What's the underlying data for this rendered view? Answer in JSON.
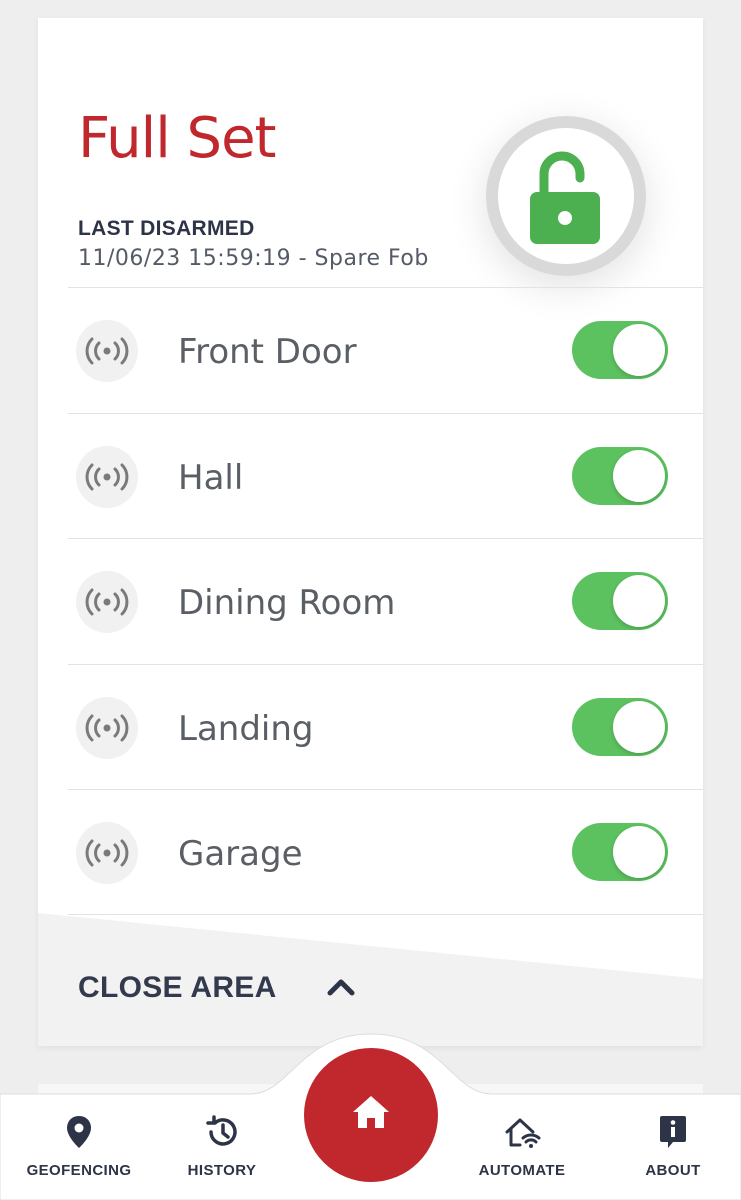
{
  "area": {
    "title": "Full Set",
    "last_event_label": "LAST DISARMED",
    "last_event_value": "11/06/23 15:59:19 - Spare Fob",
    "status_icon": "unlocked-padlock-icon",
    "status_color": "#4caf50",
    "title_color": "#c0282d"
  },
  "zones": [
    {
      "label": "Front Door",
      "enabled": true
    },
    {
      "label": "Hall",
      "enabled": true
    },
    {
      "label": "Dining Room",
      "enabled": true
    },
    {
      "label": "Landing",
      "enabled": true
    },
    {
      "label": "Garage",
      "enabled": true
    }
  ],
  "zone_icon": "wireless-sensor-icon",
  "toggle_on_color": "#5cc15f",
  "close_area": {
    "label": "CLOSE AREA",
    "icon": "chevron-up-icon"
  },
  "nav": {
    "items": [
      {
        "label": "GEOFENCING",
        "icon": "location-pin-icon"
      },
      {
        "label": "HISTORY",
        "icon": "history-icon"
      },
      {
        "label": "AUTOMATE",
        "icon": "smart-home-icon"
      },
      {
        "label": "ABOUT",
        "icon": "info-icon"
      }
    ],
    "home_icon": "home-icon",
    "home_color": "#c0282d"
  }
}
